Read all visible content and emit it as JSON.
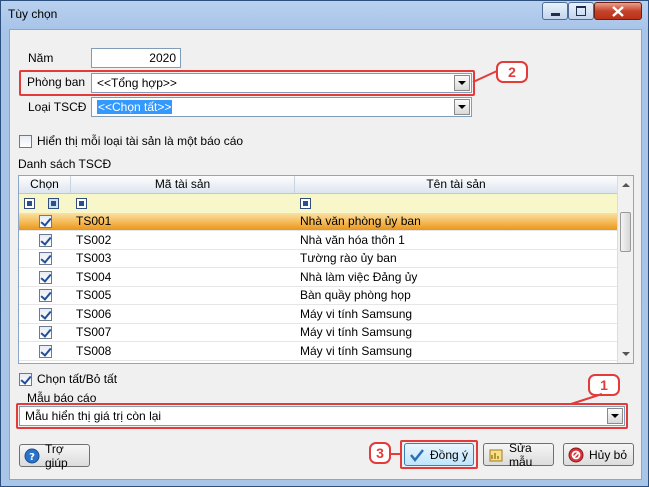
{
  "window": {
    "title": "Tùy chọn"
  },
  "form": {
    "nam_label": "Năm",
    "nam_value": "2020",
    "phongban_label": "Phòng ban",
    "phongban_value": "<<Tổng hợp>>",
    "loaitscd_label": "Loại TSCĐ",
    "loaitscd_value": "<<Chọn tất>>",
    "hienthi_label": "Hiển thị mỗi loại tài sản là một báo cáo",
    "hienthi_checked": false,
    "danhsach_label": "Danh sách TSCĐ"
  },
  "grid": {
    "columns": [
      "Chọn",
      "Mã tài sản",
      "Tên tài sản"
    ],
    "rows": [
      {
        "checked": true,
        "code": "TS001",
        "name": "Nhà văn phòng ủy ban",
        "selected": true
      },
      {
        "checked": true,
        "code": "TS002",
        "name": "Nhà văn hóa thôn 1",
        "selected": false
      },
      {
        "checked": true,
        "code": "TS003",
        "name": "Tường rào ủy ban",
        "selected": false
      },
      {
        "checked": true,
        "code": "TS004",
        "name": "Nhà làm việc Đảng ủy",
        "selected": false
      },
      {
        "checked": true,
        "code": "TS005",
        "name": "Bàn quầy phòng họp",
        "selected": false
      },
      {
        "checked": true,
        "code": "TS006",
        "name": "Máy vi tính Samsung",
        "selected": false
      },
      {
        "checked": true,
        "code": "TS007",
        "name": "Máy vi tính Samsung",
        "selected": false
      },
      {
        "checked": true,
        "code": "TS008",
        "name": "Máy vi tính Samsung",
        "selected": false
      }
    ]
  },
  "footer": {
    "chontat_label": "Chọn tất/Bỏ tất",
    "chontat_checked": true,
    "maubaocao_label": "Mẫu báo cáo",
    "maubaocao_value": "Mẫu hiển thị giá trị còn lại"
  },
  "buttons": {
    "help": "Trợ giúp",
    "ok": "Đồng ý",
    "edit": "Sửa mẫu",
    "cancel": "Hủy bỏ"
  },
  "callouts": {
    "one": "1",
    "two": "2",
    "three": "3"
  },
  "colors": {
    "highlight": "#e33a3a",
    "selection": "#f4b955",
    "combo_select": "#3399ff"
  },
  "icons": [
    "minimize-icon",
    "maximize-icon",
    "close-icon",
    "dropdown-icon",
    "help-icon",
    "check-icon",
    "edit-template-icon",
    "cancel-icon",
    "filter-icon"
  ]
}
